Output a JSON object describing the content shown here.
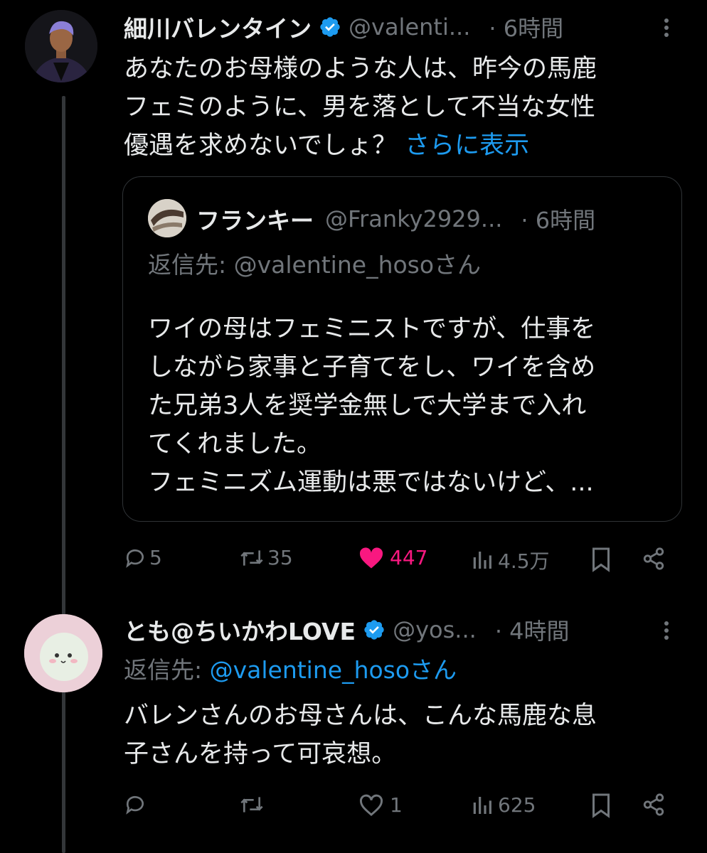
{
  "tweet1": {
    "author": "細川バレンタイン",
    "handle": "@valenti...",
    "time": "· 6時間",
    "text_lines": [
      "あなたのお母様のような人は、昨今の馬鹿",
      "フェミのように、男を落として不当な女性"
    ],
    "text_last": "優遇を求めないでしょ？ ",
    "show_more": "さらに表示",
    "quote": {
      "author": "フランキー",
      "handle": "@Franky2929...",
      "time": "· 6時間",
      "reply_to": "返信先: @valentine_hosoさん",
      "text_lines": [
        "ワイの母はフェミニストですが、仕事を",
        "しながら家事と子育てをし、ワイを含め",
        "た兄弟3人を奨学金無しで大学まで入れ",
        "てくれました。",
        "フェミニズム運動は悪ではないけど、..."
      ]
    },
    "actions": {
      "replies": "5",
      "reposts": "35",
      "likes": "447",
      "views": "4.5万"
    }
  },
  "tweet2": {
    "author": "とも@ちいかわLOVE",
    "handle": "@yos...",
    "time": "· 4時間",
    "reply_prefix": "返信先: ",
    "reply_handle": "@valentine_hosoさん",
    "text_lines": [
      "バレンさんのお母さんは、こんな馬鹿な息",
      "子さんを持って可哀想。"
    ],
    "actions": {
      "replies": "",
      "reposts": "",
      "likes": "1",
      "views": "625"
    }
  },
  "colors": {
    "background": "#000000",
    "text": "#e7e9ea",
    "muted": "#71767b",
    "link": "#1d9bf0",
    "like": "#f91880",
    "verified": "#1d9bf0"
  },
  "icons": [
    "verified-badge-icon",
    "more-icon",
    "reply-icon",
    "repost-icon",
    "like-icon",
    "views-icon",
    "bookmark-icon",
    "share-icon"
  ]
}
